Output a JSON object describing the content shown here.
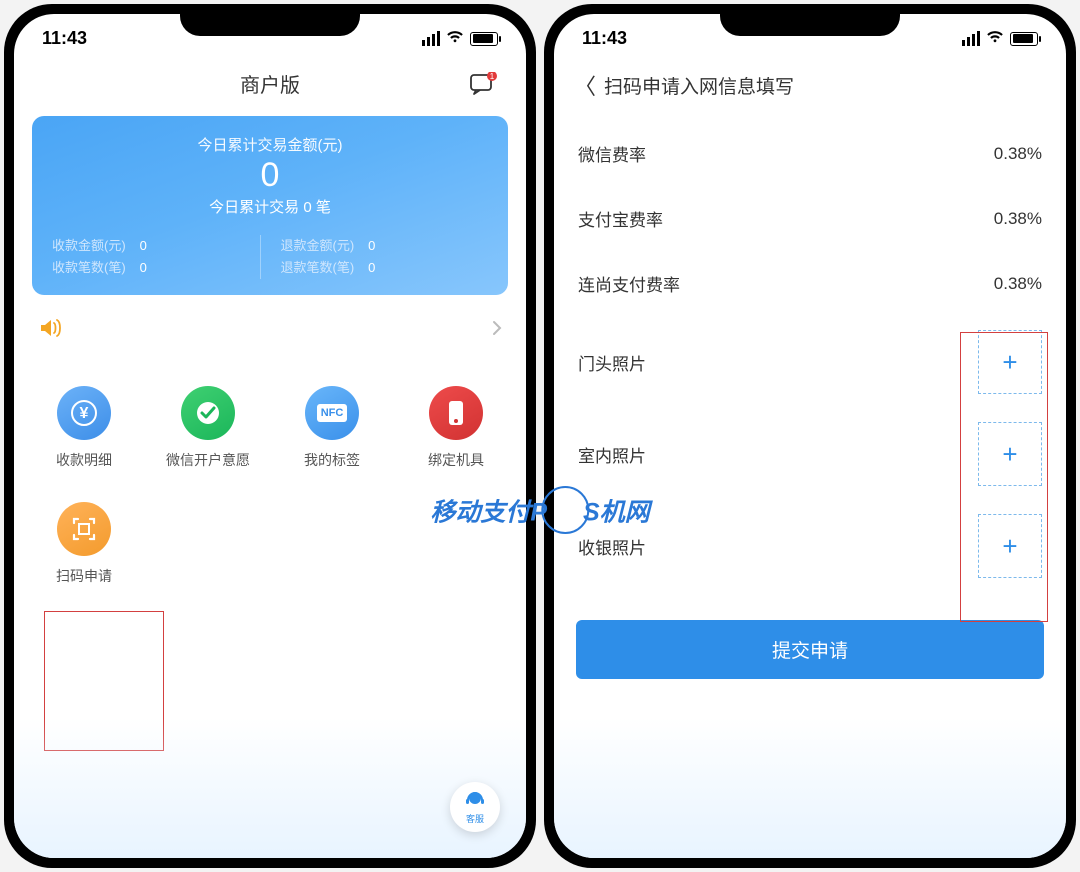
{
  "status": {
    "time": "11:43"
  },
  "left": {
    "title": "商户版",
    "chat_badge": "1",
    "summary": {
      "top_label": "今日累计交易金额(元)",
      "amount": "0",
      "sub_prefix": "今日累计交易",
      "sub_count": "0",
      "sub_suffix": "笔",
      "rows_left": [
        {
          "label": "收款金额(元)",
          "value": "0"
        },
        {
          "label": "收款笔数(笔)",
          "value": "0"
        }
      ],
      "rows_right": [
        {
          "label": "退款金额(元)",
          "value": "0"
        },
        {
          "label": "退款笔数(笔)",
          "value": "0"
        }
      ]
    },
    "grid": {
      "items": [
        {
          "label": "收款明细",
          "icon": "yen-circle"
        },
        {
          "label": "微信开户意愿",
          "icon": "check-circle"
        },
        {
          "label": "我的标签",
          "icon": "nfc-tag",
          "nfc_text": "NFC"
        },
        {
          "label": "绑定机具",
          "icon": "device"
        },
        {
          "label": "扫码申请",
          "icon": "scan"
        }
      ]
    },
    "float_label": "客服"
  },
  "right": {
    "title": "扫码申请入网信息填写",
    "rates": [
      {
        "label": "微信费率",
        "value": "0.38%"
      },
      {
        "label": "支付宝费率",
        "value": "0.38%"
      },
      {
        "label": "连尚支付费率",
        "value": "0.38%"
      }
    ],
    "uploads": [
      {
        "label": "门头照片"
      },
      {
        "label": "室内照片"
      },
      {
        "label": "收银照片"
      }
    ],
    "submit": "提交申请"
  },
  "watermark": {
    "left": "移动支付P",
    "right": "S机网"
  }
}
